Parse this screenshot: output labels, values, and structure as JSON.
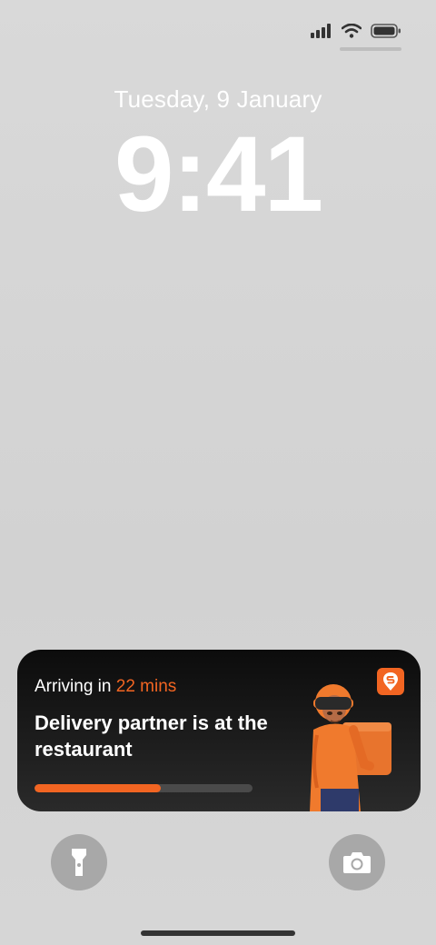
{
  "status_bar": {
    "icons": [
      "cellular-signal-icon",
      "wifi-icon",
      "battery-icon"
    ]
  },
  "lock_screen": {
    "date": "Tuesday, 9 January",
    "time": "9:41"
  },
  "live_activity": {
    "eta_prefix": "Arriving in",
    "eta_value": "22 mins",
    "status": "Delivery partner is at the restaurant",
    "progress": 0.58,
    "brand_color": "#f26522",
    "icons": [
      "brand-logo-icon",
      "delivery-rider-illustration"
    ]
  },
  "controls": {
    "left": "flashlight-icon",
    "right": "camera-icon"
  }
}
